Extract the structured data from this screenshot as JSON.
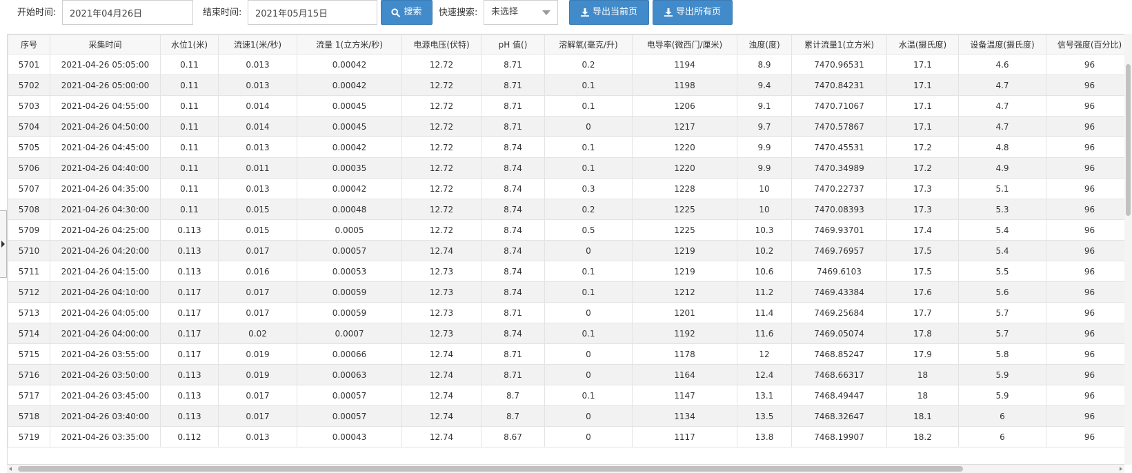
{
  "filters": {
    "start_label": "开始时间:",
    "start_value": "2021年04月26日",
    "end_label": "结束时间:",
    "end_value": "2021年05月15日",
    "search_label": "搜索",
    "quick_label": "快速搜索:",
    "quick_value": "未选择",
    "export_current_label": "导出当前页",
    "export_all_label": "导出所有页"
  },
  "colors": {
    "primary": "#428bca",
    "row_alt": "#f2f2f2"
  },
  "table": {
    "columns": [
      "序号",
      "采集时间",
      "水位1(米)",
      "流速1(米/秒)",
      "流量 1(立方米/秒)",
      "电源电压(伏特)",
      "pH 值()",
      "溶解氧(毫克/升)",
      "电导率(微西门/厘米)",
      "浊度(度)",
      "累计流量1(立方米)",
      "水温(摄氏度)",
      "设备温度(摄氏度)",
      "信号强度(百分比)"
    ],
    "rows": [
      [
        "5701",
        "2021-04-26 05:05:00",
        "0.11",
        "0.013",
        "0.00042",
        "12.72",
        "8.71",
        "0.2",
        "1194",
        "8.9",
        "7470.96531",
        "17.1",
        "4.6",
        "96"
      ],
      [
        "5702",
        "2021-04-26 05:00:00",
        "0.11",
        "0.013",
        "0.00042",
        "12.72",
        "8.71",
        "0.1",
        "1198",
        "9.4",
        "7470.84231",
        "17.1",
        "4.7",
        "96"
      ],
      [
        "5703",
        "2021-04-26 04:55:00",
        "0.11",
        "0.014",
        "0.00045",
        "12.72",
        "8.71",
        "0.1",
        "1206",
        "9.1",
        "7470.71067",
        "17.1",
        "4.7",
        "96"
      ],
      [
        "5704",
        "2021-04-26 04:50:00",
        "0.11",
        "0.014",
        "0.00045",
        "12.72",
        "8.71",
        "0",
        "1217",
        "9.7",
        "7470.57867",
        "17.1",
        "4.7",
        "96"
      ],
      [
        "5705",
        "2021-04-26 04:45:00",
        "0.11",
        "0.013",
        "0.00042",
        "12.72",
        "8.74",
        "0.1",
        "1220",
        "9.9",
        "7470.45531",
        "17.2",
        "4.8",
        "96"
      ],
      [
        "5706",
        "2021-04-26 04:40:00",
        "0.11",
        "0.011",
        "0.00035",
        "12.72",
        "8.74",
        "0.1",
        "1220",
        "9.9",
        "7470.34989",
        "17.2",
        "4.9",
        "96"
      ],
      [
        "5707",
        "2021-04-26 04:35:00",
        "0.11",
        "0.013",
        "0.00042",
        "12.72",
        "8.74",
        "0.3",
        "1228",
        "10",
        "7470.22737",
        "17.3",
        "5.1",
        "96"
      ],
      [
        "5708",
        "2021-04-26 04:30:00",
        "0.11",
        "0.015",
        "0.00048",
        "12.72",
        "8.74",
        "0.2",
        "1225",
        "10",
        "7470.08393",
        "17.3",
        "5.3",
        "96"
      ],
      [
        "5709",
        "2021-04-26 04:25:00",
        "0.113",
        "0.015",
        "0.0005",
        "12.72",
        "8.74",
        "0.5",
        "1225",
        "10.3",
        "7469.93701",
        "17.4",
        "5.4",
        "96"
      ],
      [
        "5710",
        "2021-04-26 04:20:00",
        "0.113",
        "0.017",
        "0.00057",
        "12.74",
        "8.74",
        "0",
        "1219",
        "10.2",
        "7469.76957",
        "17.5",
        "5.4",
        "96"
      ],
      [
        "5711",
        "2021-04-26 04:15:00",
        "0.113",
        "0.016",
        "0.00053",
        "12.73",
        "8.74",
        "0.1",
        "1219",
        "10.6",
        "7469.6103",
        "17.5",
        "5.5",
        "96"
      ],
      [
        "5712",
        "2021-04-26 04:10:00",
        "0.117",
        "0.017",
        "0.00059",
        "12.73",
        "8.74",
        "0.1",
        "1212",
        "11.2",
        "7469.43384",
        "17.6",
        "5.6",
        "96"
      ],
      [
        "5713",
        "2021-04-26 04:05:00",
        "0.117",
        "0.017",
        "0.00059",
        "12.73",
        "8.71",
        "0",
        "1201",
        "11.4",
        "7469.25684",
        "17.7",
        "5.7",
        "96"
      ],
      [
        "5714",
        "2021-04-26 04:00:00",
        "0.117",
        "0.02",
        "0.0007",
        "12.73",
        "8.74",
        "0.1",
        "1192",
        "11.6",
        "7469.05074",
        "17.8",
        "5.7",
        "96"
      ],
      [
        "5715",
        "2021-04-26 03:55:00",
        "0.117",
        "0.019",
        "0.00066",
        "12.74",
        "8.71",
        "0",
        "1178",
        "12",
        "7468.85247",
        "17.9",
        "5.8",
        "96"
      ],
      [
        "5716",
        "2021-04-26 03:50:00",
        "0.113",
        "0.019",
        "0.00063",
        "12.74",
        "8.71",
        "0",
        "1164",
        "12.4",
        "7468.66317",
        "18",
        "5.9",
        "96"
      ],
      [
        "5717",
        "2021-04-26 03:45:00",
        "0.113",
        "0.017",
        "0.00057",
        "12.74",
        "8.7",
        "0.1",
        "1147",
        "13.1",
        "7468.49447",
        "18",
        "5.9",
        "96"
      ],
      [
        "5718",
        "2021-04-26 03:40:00",
        "0.113",
        "0.017",
        "0.00057",
        "12.74",
        "8.7",
        "0",
        "1134",
        "13.5",
        "7468.32647",
        "18.1",
        "6",
        "96"
      ],
      [
        "5719",
        "2021-04-26 03:35:00",
        "0.112",
        "0.013",
        "0.00043",
        "12.74",
        "8.67",
        "0",
        "1117",
        "13.8",
        "7468.19907",
        "18.2",
        "6",
        "96"
      ]
    ]
  }
}
